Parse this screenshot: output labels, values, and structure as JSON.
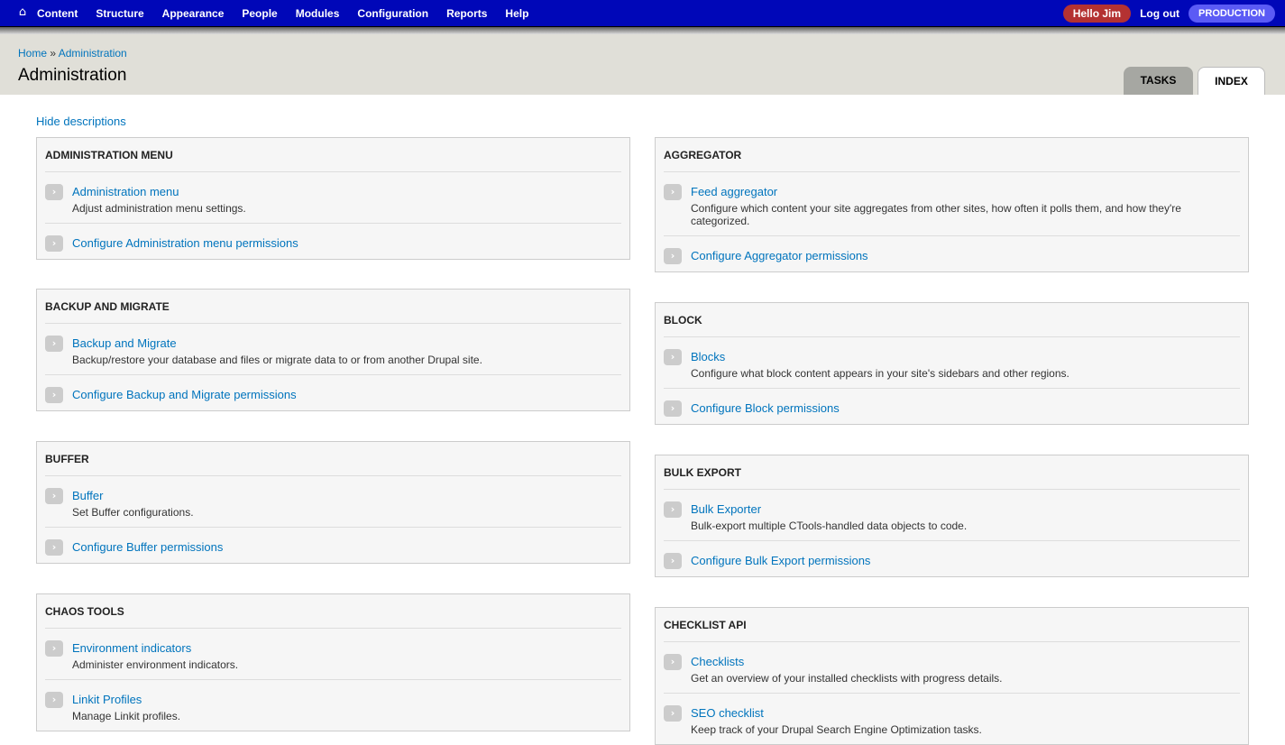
{
  "toolbar": {
    "menu": [
      "Content",
      "Structure",
      "Appearance",
      "People",
      "Modules",
      "Configuration",
      "Reports",
      "Help"
    ],
    "hello": "Hello Jim",
    "logout": "Log out",
    "environment": "PRODUCTION"
  },
  "header": {
    "breadcrumb": [
      "Home",
      "Administration"
    ],
    "breadcrumb_sep": " » ",
    "title": "Administration",
    "tabs": [
      "TASKS",
      "INDEX"
    ]
  },
  "hide_descriptions": "Hide descriptions",
  "panels": [
    {
      "title": "ADMINISTRATION MENU",
      "items": [
        {
          "title": "Administration menu",
          "desc": "Adjust administration menu settings."
        },
        {
          "title": "Configure Administration menu permissions",
          "desc": ""
        }
      ]
    },
    {
      "title": "BACKUP AND MIGRATE",
      "items": [
        {
          "title": "Backup and Migrate",
          "desc": "Backup/restore your database and files or migrate data to or from another Drupal site."
        },
        {
          "title": "Configure Backup and Migrate permissions",
          "desc": ""
        }
      ]
    },
    {
      "title": "BUFFER",
      "items": [
        {
          "title": "Buffer",
          "desc": "Set Buffer configurations."
        },
        {
          "title": "Configure Buffer permissions",
          "desc": ""
        }
      ]
    },
    {
      "title": "CHAOS TOOLS",
      "items": [
        {
          "title": "Environment indicators",
          "desc": "Administer environment indicators."
        },
        {
          "title": "Linkit Profiles",
          "desc": "Manage Linkit profiles."
        }
      ]
    },
    {
      "title": "AGGREGATOR",
      "items": [
        {
          "title": "Feed aggregator",
          "desc": "Configure which content your site aggregates from other sites, how often it polls them, and how they're categorized."
        },
        {
          "title": "Configure Aggregator permissions",
          "desc": ""
        }
      ]
    },
    {
      "title": "BLOCK",
      "items": [
        {
          "title": "Blocks",
          "desc": "Configure what block content appears in your site's sidebars and other regions."
        },
        {
          "title": "Configure Block permissions",
          "desc": ""
        }
      ]
    },
    {
      "title": "BULK EXPORT",
      "items": [
        {
          "title": "Bulk Exporter",
          "desc": "Bulk-export multiple CTools-handled data objects to code."
        },
        {
          "title": "Configure Bulk Export permissions",
          "desc": ""
        }
      ]
    },
    {
      "title": "CHECKLIST API",
      "items": [
        {
          "title": "Checklists",
          "desc": "Get an overview of your installed checklists with progress details."
        },
        {
          "title": "SEO checklist",
          "desc": "Keep track of your Drupal Search Engine Optimization tasks."
        }
      ]
    }
  ]
}
